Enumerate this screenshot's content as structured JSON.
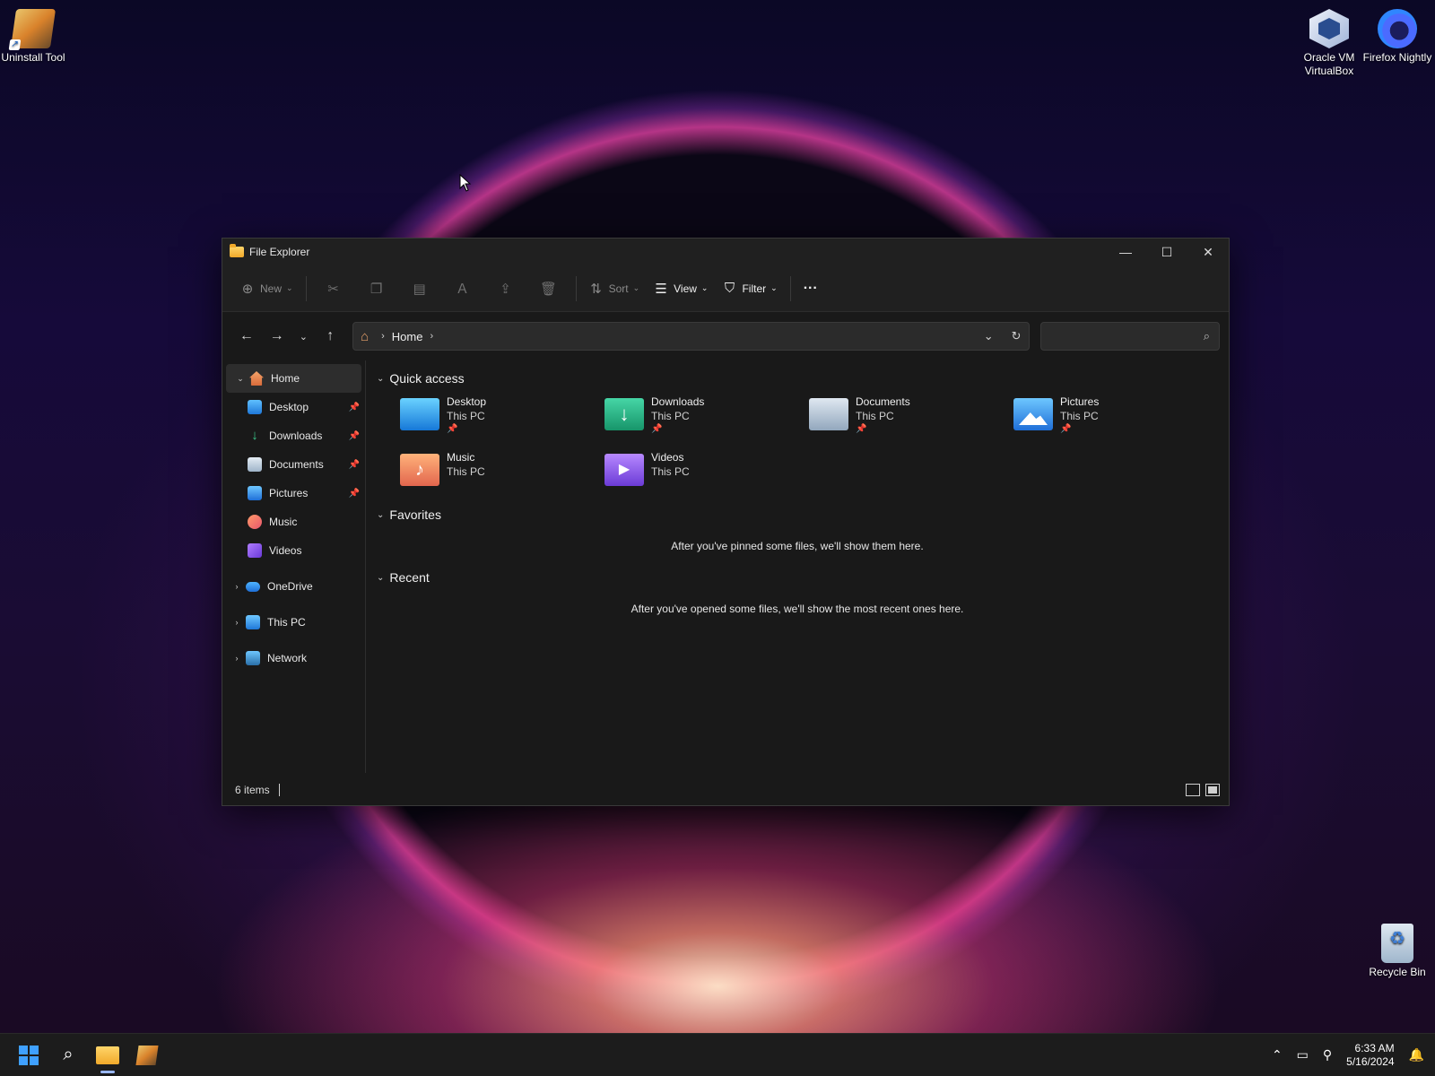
{
  "desktop": {
    "icons": [
      {
        "label": "Uninstall Tool",
        "icon": "uninstall-tool-icon"
      },
      {
        "label": "Oracle VM VirtualBox",
        "icon": "virtualbox-icon"
      },
      {
        "label": "Firefox Nightly",
        "icon": "firefox-nightly-icon"
      },
      {
        "label": "Recycle Bin",
        "icon": "recycle-bin-icon"
      }
    ]
  },
  "window": {
    "title": "File Explorer",
    "controls": {
      "minimize": "—",
      "maximize": "☐",
      "close": "✕"
    },
    "commandbar": {
      "new_label": "New",
      "sort_label": "Sort",
      "view_label": "View",
      "filter_label": "Filter",
      "more_label": "···"
    },
    "address": {
      "crumb": "Home",
      "search_placeholder": ""
    },
    "nav": {
      "home": "Home",
      "quick": [
        {
          "label": "Desktop",
          "pinned": true
        },
        {
          "label": "Downloads",
          "pinned": true
        },
        {
          "label": "Documents",
          "pinned": true
        },
        {
          "label": "Pictures",
          "pinned": true
        },
        {
          "label": "Music",
          "pinned": false
        },
        {
          "label": "Videos",
          "pinned": false
        }
      ],
      "onedrive": "OneDrive",
      "thispc": "This PC",
      "network": "Network"
    },
    "content": {
      "quick_access": "Quick access",
      "items": [
        {
          "name": "Desktop",
          "location": "This PC",
          "pinned": true
        },
        {
          "name": "Downloads",
          "location": "This PC",
          "pinned": true
        },
        {
          "name": "Documents",
          "location": "This PC",
          "pinned": true
        },
        {
          "name": "Pictures",
          "location": "This PC",
          "pinned": true
        },
        {
          "name": "Music",
          "location": "This PC",
          "pinned": false
        },
        {
          "name": "Videos",
          "location": "This PC",
          "pinned": false
        }
      ],
      "favorites": "Favorites",
      "favorites_empty": "After you've pinned some files, we'll show them here.",
      "recent": "Recent",
      "recent_empty": "After you've opened some files, we'll show the most recent ones here."
    },
    "status": {
      "items": "6 items"
    }
  },
  "taskbar": {
    "time": "6:33 AM",
    "date": "5/16/2024"
  },
  "colors": {
    "accent": "#3fa0ff",
    "window_bg": "#191919"
  }
}
